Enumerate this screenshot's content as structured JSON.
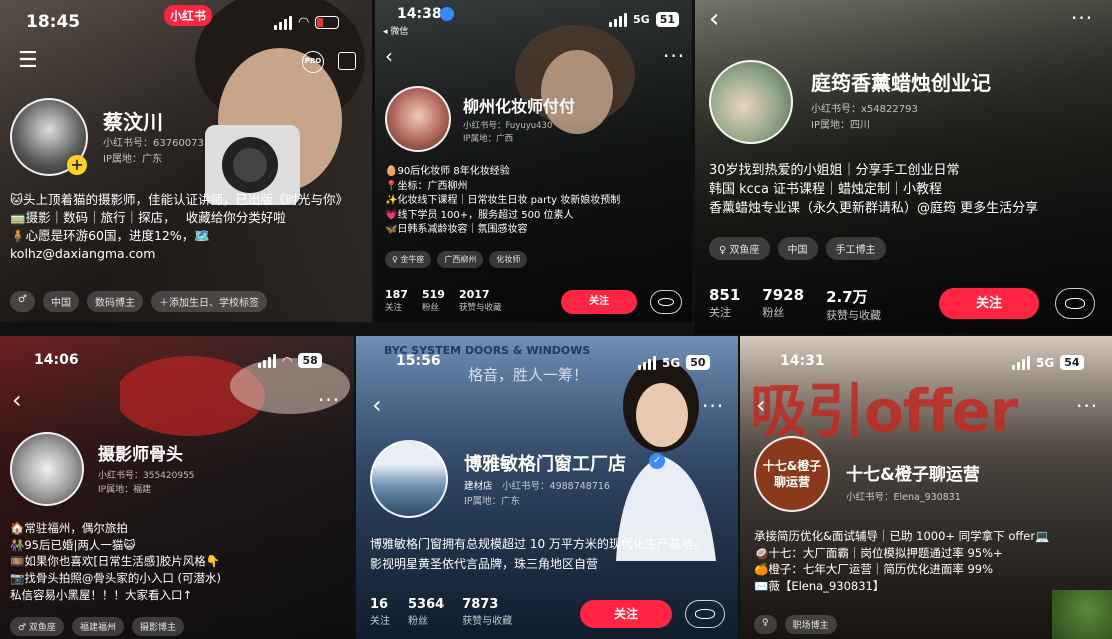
{
  "p1": {
    "time": "18:45",
    "app_badge": "小红书",
    "name": "蔡汶川",
    "id": "小红书号：63760073",
    "ip": "IP属地：广东",
    "pro": "PRO",
    "bio": [
      "🐱头上顶着猫的摄影师，佳能认证讲师，已出版《时光与你》",
      "🚃摄影｜数码｜旅行｜探店，　 收藏给你分类好啦",
      "🧍心愿是环游60国，进度12%，🗺️",
      "kolhz@daxiangma.com"
    ],
    "tags": [
      "♂",
      "中国",
      "数码博主",
      "＋添加生日、学校标签"
    ]
  },
  "p2": {
    "time": "14:38",
    "back_app": "◂ 微信",
    "net": "5G",
    "battery": "51",
    "name": "柳州化妆师付付",
    "id": "小红书号：Fuyuyu430",
    "ip": "IP属地：广西",
    "bio": [
      "🥚90后化妆师 8年化妆经验",
      "📍坐标：广西柳州",
      "✨化妆线下课程｜日常妆生日妆 party 妆新娘妆预制",
      "💗线下学员 100+，服务超过 500 位素人",
      "🦋日韩系减龄妆容｜氛围感妆容"
    ],
    "tags": [
      "♀ 金牛座",
      "广西柳州",
      "化妆师"
    ],
    "stats": [
      {
        "n": "187",
        "l": "关注"
      },
      {
        "n": "519",
        "l": "粉丝"
      },
      {
        "n": "2017",
        "l": "获赞与收藏"
      }
    ],
    "follow": "关注"
  },
  "p3": {
    "name": "庭筠香薰蜡烛创业记",
    "id": "小红书号：x54822793",
    "ip": "IP属地：四川",
    "bio": [
      "30岁找到热爱的小姐姐｜分享手工创业日常",
      "韩国 kcca 证书课程｜蜡烛定制｜小教程",
      "香薰蜡烛专业课（永久更新群请私）@庭筠 更多生活分享"
    ],
    "tags": [
      "♀ 双鱼座",
      "中国",
      "手工博主"
    ],
    "stats": [
      {
        "n": "851",
        "l": "关注"
      },
      {
        "n": "7928",
        "l": "粉丝"
      },
      {
        "n": "2.7万",
        "l": "获赞与收藏"
      }
    ],
    "follow": "关注"
  },
  "p4": {
    "time": "14:06",
    "battery": "58",
    "name": "摄影师骨头",
    "id": "小红书号：355420955",
    "ip": "IP属地：福建",
    "bio": [
      "🏠常驻福州，偶尔旅拍",
      "👫95后已婚|两人一猫😺",
      "🎞️如果你也喜欢[日常生活感]胶片风格👇",
      "📷找骨头拍照@骨头家的小入口 (可潜水)",
      "私信容易小黑屋！！！大家看入口↑"
    ],
    "tags": [
      "♂ 双鱼座",
      "福建福州",
      "摄影博主"
    ]
  },
  "p5": {
    "time": "15:56",
    "net": "5G",
    "battery": "50",
    "banner_top": "BYC SYSTEM DOORS & WINDOWS",
    "banner_slogan": "格音，胜人一筹！",
    "name": "博雅敏格门窗工厂店",
    "category": "建材店",
    "id": "小红书号：4988748716",
    "ip": "IP属地：广东",
    "bio": [
      "博雅敏格门窗拥有总规模超过 10 万平方米的现代化生产基地，影视明星黄圣依代言品牌，珠三角地区自营"
    ],
    "stats": [
      {
        "n": "16",
        "l": "关注"
      },
      {
        "n": "5364",
        "l": "粉丝"
      },
      {
        "n": "7873",
        "l": "获赞与收藏"
      }
    ],
    "follow": "关注"
  },
  "p6": {
    "time": "14:31",
    "net": "5G",
    "battery": "54",
    "banner": "吸引offer",
    "avatar_text": "十七&橙子\n聊运营",
    "name": "十七&橙子聊运营",
    "id": "小红书号：Elena_930831",
    "bio": [
      "承接简历优化&面试辅导｜已助 1000+ 同学拿下 offer💻",
      "🥥十七：大厂面霸｜岗位模拟押题通过率 95%+",
      "🍊橙子：七年大厂运营｜简历优化进面率 99%",
      "✉️薇【Elena_930831】"
    ],
    "tags": [
      "♀",
      "职场博主"
    ]
  }
}
